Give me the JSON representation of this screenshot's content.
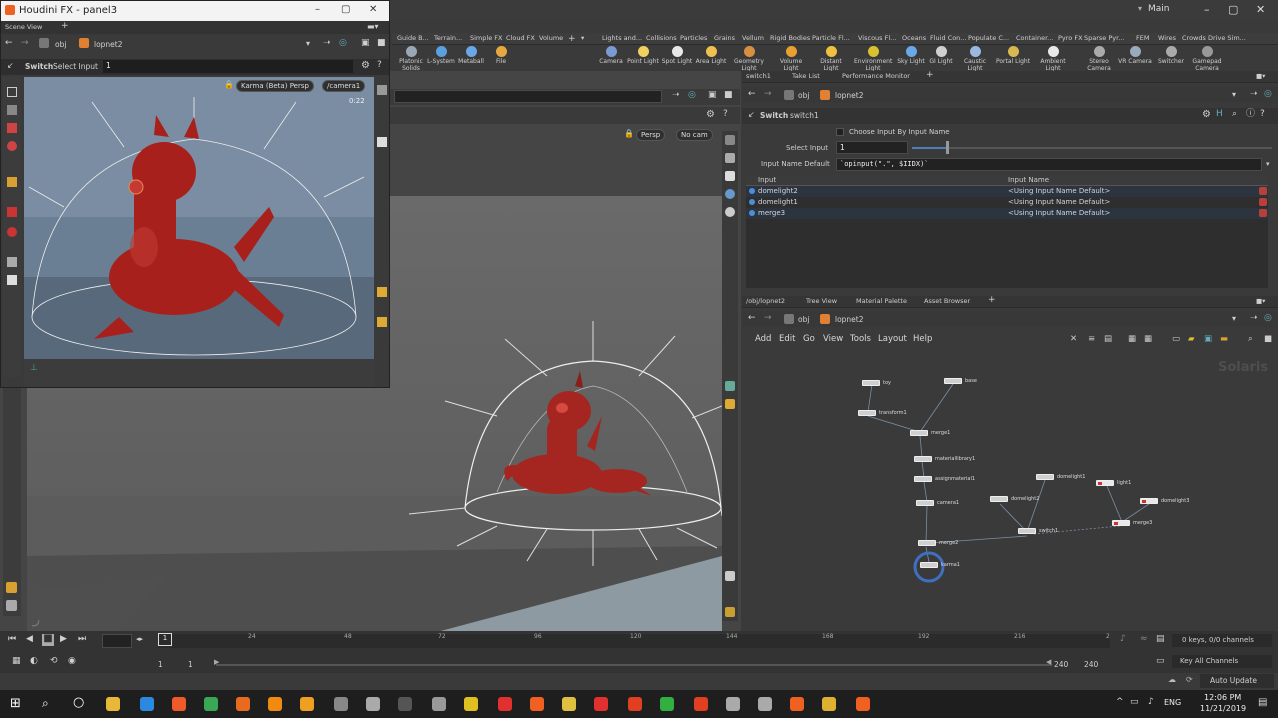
{
  "main_window": {
    "workspace": "Main",
    "controls": [
      "–",
      "▢",
      "✕"
    ]
  },
  "float_window": {
    "title": "Houdini FX - panel3",
    "controls": [
      "–",
      "▢",
      "✕"
    ],
    "pane_tab": "Scene View",
    "path": "obj",
    "path_node": "lopnet2",
    "switch_label": "Switch",
    "select_input_label": "Select Input",
    "select_input_value": "1",
    "renderer": "Karma (Beta)",
    "view": "Persp",
    "camera": "/camera1",
    "render_time": "0:22"
  },
  "shelf": {
    "tabs_left": [
      "Guide B...",
      "Terrain...",
      "Simple FX",
      "Cloud FX",
      "Volume"
    ],
    "tabs_right": [
      "Lights and...",
      "Collisions",
      "Particles",
      "Grains",
      "Vellum",
      "Rigid Bodies",
      "Particle Fl...",
      "Viscous Fl...",
      "Oceans",
      "Fluid Con...",
      "Populate C...",
      "Container...",
      "Pyro FX",
      "Sparse Pyr...",
      "FEM",
      "Wires",
      "Crowds",
      "Drive Sim..."
    ],
    "tools_left": [
      {
        "label": "Platonic Solids",
        "color": "#9aa8b6"
      },
      {
        "label": "L-System",
        "color": "#5aa0e0"
      },
      {
        "label": "Metaball",
        "color": "#6aa7e6"
      },
      {
        "label": "File",
        "color": "#e8a840"
      }
    ],
    "tools_right": [
      {
        "label": "Camera",
        "color": "#7a9bd0"
      },
      {
        "label": "Point Light",
        "color": "#f0d060"
      },
      {
        "label": "Spot Light",
        "color": "#e8e8e8"
      },
      {
        "label": "Area Light",
        "color": "#f0c050"
      },
      {
        "label": "Geometry Light",
        "color": "#d89040"
      },
      {
        "label": "Volume Light",
        "color": "#e8a030"
      },
      {
        "label": "Distant Light",
        "color": "#f0c040"
      },
      {
        "label": "Environment Light",
        "color": "#d8c030"
      },
      {
        "label": "Sky Light",
        "color": "#6aa8e8"
      },
      {
        "label": "GI Light",
        "color": "#d0d0d0"
      },
      {
        "label": "Caustic Light",
        "color": "#9ab8e0"
      },
      {
        "label": "Portal Light",
        "color": "#d8b850"
      },
      {
        "label": "Ambient Light",
        "color": "#e8e8e8"
      },
      {
        "label": "Stereo Camera",
        "color": "#aaaaaa"
      },
      {
        "label": "VR Camera",
        "color": "#9ab"
      },
      {
        "label": "Switcher",
        "color": "#aaa"
      },
      {
        "label": "Gamepad Camera",
        "color": "#999"
      }
    ]
  },
  "viewport": {
    "view": "Persp",
    "camera": "No cam"
  },
  "parameters": {
    "tabs": [
      "switch1",
      "Take List",
      "Performance Monitor"
    ],
    "path": "obj",
    "path_node": "lopnet2",
    "node_type": "Switch",
    "node_name": "switch1",
    "choose_by_name_label": "Choose Input By Input Name",
    "select_input_label": "Select Input",
    "select_input_value": "1",
    "input_name_default_label": "Input Name Default",
    "input_name_default_value": "`opinput(\".\", $IIDX)`",
    "table_headers": [
      "Input",
      "Input Name"
    ],
    "rows": [
      {
        "input": "domelight2",
        "name": "<Using Input Name Default>"
      },
      {
        "input": "domelight1",
        "name": "<Using Input Name Default>"
      },
      {
        "input": "merge3",
        "name": "<Using Input Name Default>"
      }
    ]
  },
  "network": {
    "tabs": [
      "/obj/lopnet2",
      "Tree View",
      "Material Palette",
      "Asset Browser"
    ],
    "path": "obj",
    "path_node": "lopnet2",
    "menu": [
      "Add",
      "Edit",
      "Go",
      "View",
      "Tools",
      "Layout",
      "Help"
    ],
    "context_label": "Solaris",
    "nodes": [
      {
        "name": "toy"
      },
      {
        "name": "base"
      },
      {
        "name": "transform1"
      },
      {
        "name": "merge1"
      },
      {
        "name": "materiallibrary1"
      },
      {
        "name": "assignmaterial1"
      },
      {
        "name": "camera1"
      },
      {
        "name": "domelight1"
      },
      {
        "name": "domelight2"
      },
      {
        "name": "switch1"
      },
      {
        "name": "light1"
      },
      {
        "name": "domelight3"
      },
      {
        "name": "merge3"
      },
      {
        "name": "merge2"
      },
      {
        "name": "karma1"
      }
    ]
  },
  "timeline": {
    "ticks": [
      "24",
      "48",
      "72",
      "96",
      "120",
      "144",
      "168",
      "192",
      "216",
      "2"
    ],
    "current_frame": "1",
    "start_frame": "1",
    "start_frame2": "1",
    "end_frame": "240",
    "end_frame2": "240",
    "keys_info": "0 keys, 0/0 channels",
    "key_channels": "Key All Channels",
    "auto_update": "Auto Update"
  },
  "taskbar": {
    "language": "ENG",
    "time": "12:06 PM",
    "date": "11/21/2019",
    "apps": [
      {
        "name": "explorer",
        "color": "#e8b838"
      },
      {
        "name": "edge",
        "color": "#2b8ae0"
      },
      {
        "name": "brave",
        "color": "#f05a28"
      },
      {
        "name": "chrome",
        "color": "#3aa757"
      },
      {
        "name": "firefox",
        "color": "#e86a20"
      },
      {
        "name": "vlc",
        "color": "#f08a10"
      },
      {
        "name": "search-app",
        "color": "#f0a020"
      },
      {
        "name": "daz",
        "color": "#888888"
      },
      {
        "name": "app-cloud",
        "color": "#aaaaaa"
      },
      {
        "name": "app-dark",
        "color": "#555555"
      },
      {
        "name": "app-tool",
        "color": "#999999"
      },
      {
        "name": "maya",
        "color": "#e0c020"
      },
      {
        "name": "app-red",
        "color": "#e03030"
      },
      {
        "name": "houdini1",
        "color": "#f06020"
      },
      {
        "name": "app-tri",
        "color": "#e0c040"
      },
      {
        "name": "app-m",
        "color": "#e03030"
      },
      {
        "name": "app-s",
        "color": "#e04020"
      },
      {
        "name": "app-green",
        "color": "#30b040"
      },
      {
        "name": "app-c",
        "color": "#e04020"
      },
      {
        "name": "app-arrow",
        "color": "#aaaaaa"
      },
      {
        "name": "app-flow",
        "color": "#aaaaaa"
      },
      {
        "name": "houdini2",
        "color": "#f06020"
      },
      {
        "name": "app-film",
        "color": "#e0b030"
      },
      {
        "name": "houdini3",
        "color": "#f06020"
      }
    ]
  }
}
